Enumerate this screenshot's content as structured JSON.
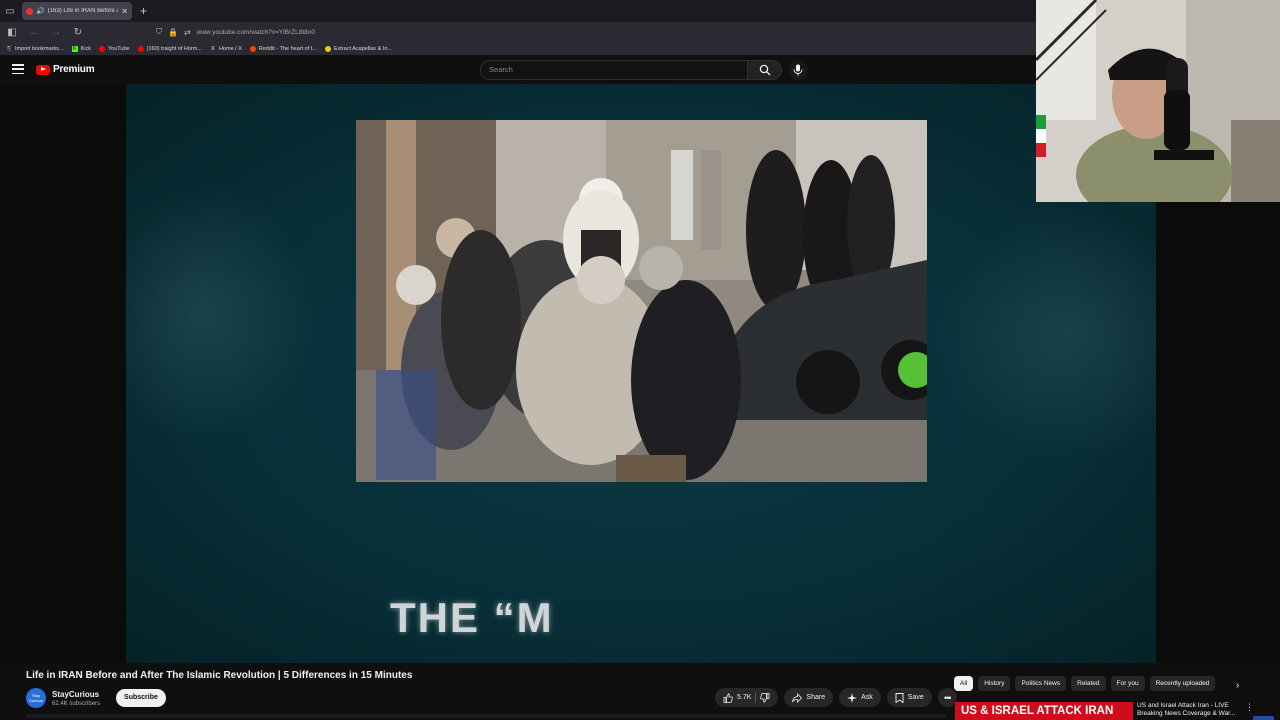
{
  "browser": {
    "tab_title": "(163) Life in IRAN Before a",
    "url": "www.youtube.com/watch?v=YlBrZL8t8n0",
    "bookmarks": [
      {
        "label": "Import bookmarks...",
        "color": "#aaaaaa"
      },
      {
        "label": "Kick",
        "color": "#53fc18"
      },
      {
        "label": "YouTube",
        "color": "#ff0000"
      },
      {
        "label": "(160) traight of Horm...",
        "color": "#ff0000"
      },
      {
        "label": "Home / X",
        "color": "#ffffff"
      },
      {
        "label": "Reddit - The heart of t...",
        "color": "#ff4500"
      },
      {
        "label": "Extract Acapellas & In...",
        "color": "#f5c518"
      }
    ]
  },
  "youtube": {
    "logo_text": "Premium",
    "search_placeholder": "Search"
  },
  "player": {
    "overlay_text": "THE “M"
  },
  "video": {
    "title": "Life in IRAN Before and After The Islamic Revolution | 5 Differences in 15 Minutes",
    "channel_name": "StayCurious",
    "channel_avatar_text": "Stay Curious",
    "subscribers": "62.4K subscribers",
    "subscribe_label": "Subscribe",
    "likes": "5.7K",
    "share_label": "Share",
    "ask_label": "Ask",
    "save_label": "Save"
  },
  "chips": [
    "All",
    "History",
    "Politics News",
    "Related",
    "For you",
    "Recently uploaded"
  ],
  "related": {
    "thumb_text": "US & ISRAEL ATTACK IRAN",
    "title_line1": "US and Israel Attack Iran - LIVE",
    "title_line2": "Breaking News Coverage & War..."
  },
  "colors": {
    "accent": "#ff0000",
    "frame_teal": "#083039",
    "breaking_red": "#d00c1c"
  }
}
